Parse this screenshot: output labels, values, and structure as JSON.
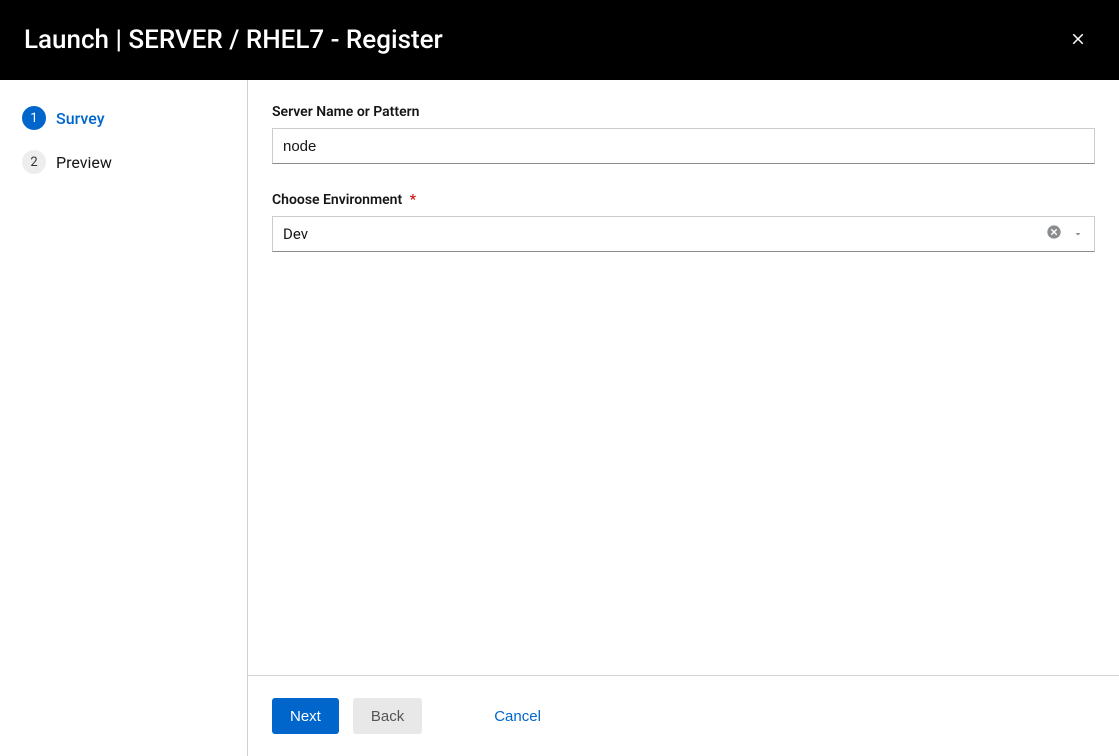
{
  "header": {
    "title": "Launch | SERVER / RHEL7 - Register"
  },
  "steps": [
    {
      "number": "1",
      "label": "Survey",
      "active": true
    },
    {
      "number": "2",
      "label": "Preview",
      "active": false
    }
  ],
  "form": {
    "server_name": {
      "label": "Server Name or Pattern",
      "value": "node",
      "required": false
    },
    "environment": {
      "label": "Choose Environment",
      "value": "Dev",
      "required": true
    }
  },
  "footer": {
    "next": "Next",
    "back": "Back",
    "cancel": "Cancel"
  }
}
